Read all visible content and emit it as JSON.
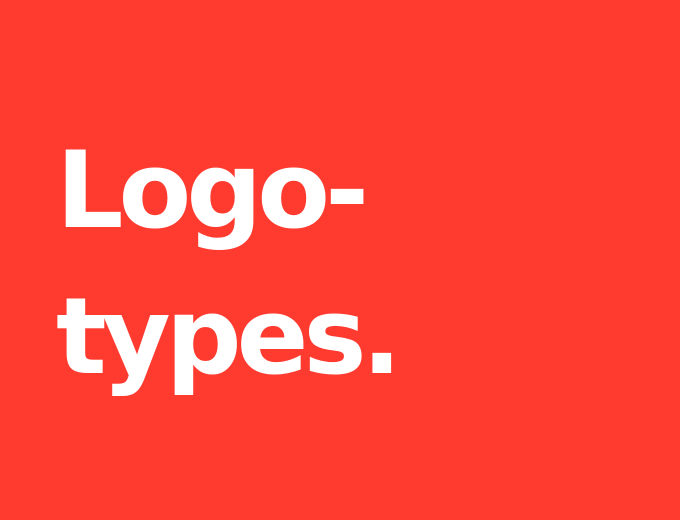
{
  "colors": {
    "background": "#ff3b30",
    "text": "#ffffff"
  },
  "headline": {
    "line1": "Logo-",
    "line2": "types."
  }
}
